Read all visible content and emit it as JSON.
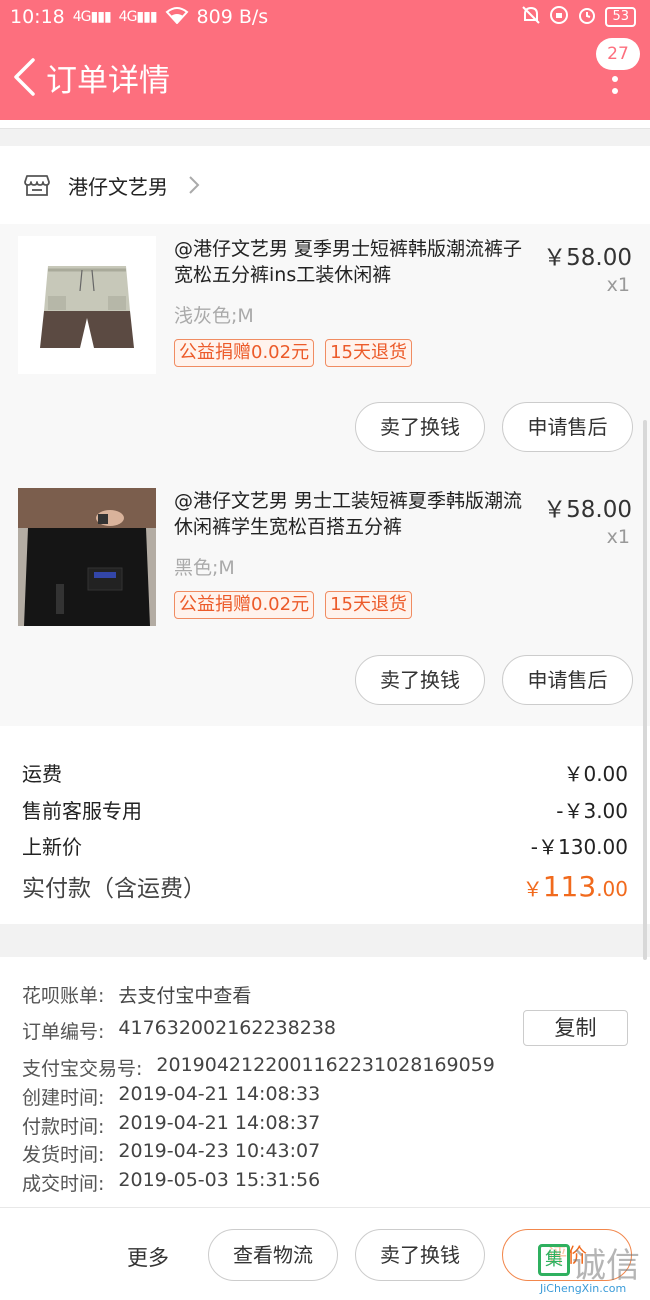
{
  "status_bar": {
    "time": "10:18",
    "signal1": "4G",
    "signal2": "4G",
    "network_speed": "809 B/s",
    "battery": "53"
  },
  "header": {
    "title": "订单详情",
    "notification_count": "27"
  },
  "shop": {
    "name": "港仔文艺男"
  },
  "items": [
    {
      "title": "@港仔文艺男 夏季男士短裤韩版潮流裤子宽松五分裤ins工装休闲裤",
      "price": "￥58.00",
      "qty": "x1",
      "spec": "浅灰色;M",
      "tag_donation": "公益捐赠0.02元",
      "tag_return": "15天退货",
      "btn_resell": "卖了换钱",
      "btn_aftersale": "申请售后"
    },
    {
      "title": "@港仔文艺男 男士工装短裤夏季韩版潮流休闲裤学生宽松百搭五分裤",
      "price": "￥58.00",
      "qty": "x1",
      "spec": "黑色;M",
      "tag_donation": "公益捐赠0.02元",
      "tag_return": "15天退货",
      "btn_resell": "卖了换钱",
      "btn_aftersale": "申请售后"
    }
  ],
  "fees": {
    "shipping_label": "运费",
    "shipping_value": "￥0.00",
    "presale_label": "售前客服专用",
    "presale_value": "-￥3.00",
    "newprice_label": "上新价",
    "newprice_value": "-￥130.00",
    "paid_label": "实付款（含运费）",
    "paid_symbol": "￥",
    "paid_int": "113",
    "paid_dec": ".00"
  },
  "order_info": {
    "huabei_label": "花呗账单:",
    "huabei_value": "去支付宝中查看",
    "order_no_label": "订单编号:",
    "order_no_value": "417632002162238238",
    "copy_label": "复制",
    "alipay_label": "支付宝交易号:",
    "alipay_value": "2019042122001162231028169059",
    "created_label": "创建时间:",
    "created_value": "2019-04-21 14:08:33",
    "paid_label": "付款时间:",
    "paid_value": "2019-04-21 14:08:37",
    "shipped_label": "发货时间:",
    "shipped_value": "2019-04-23 10:43:07",
    "done_label": "成交时间:",
    "done_value": "2019-05-03 15:31:56"
  },
  "bottom_bar": {
    "more": "更多",
    "logistics": "查看物流",
    "resell": "卖了换钱",
    "review": "评价"
  },
  "watermark": {
    "logo_text": "集",
    "text": "诚信",
    "url": "JiChengXin.com"
  },
  "colors": {
    "brand_pink": "#fd6f7e",
    "accent_orange": "#f16a1d"
  }
}
